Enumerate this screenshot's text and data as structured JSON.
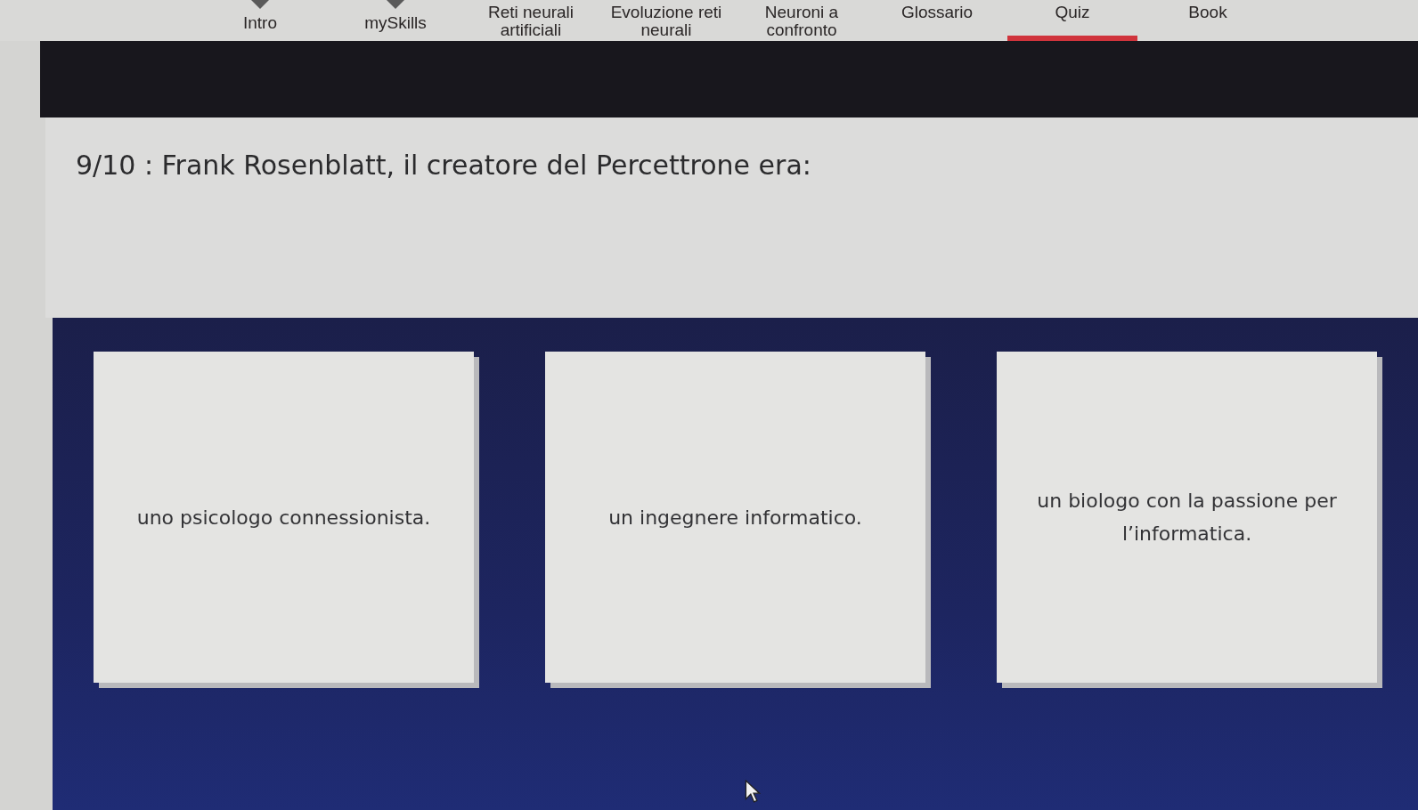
{
  "nav": {
    "items": [
      {
        "label": "Intro",
        "dropdown": true,
        "selected": false
      },
      {
        "label": "mySkills",
        "dropdown": true,
        "selected": false
      },
      {
        "label": "Reti neurali artificiali",
        "dropdown": false,
        "selected": false
      },
      {
        "label": "Evoluzione reti neurali",
        "dropdown": false,
        "selected": false
      },
      {
        "label": "Neuroni a confronto",
        "dropdown": false,
        "selected": false
      },
      {
        "label": "Glossario",
        "dropdown": false,
        "selected": false
      },
      {
        "label": "Quiz",
        "dropdown": false,
        "selected": true
      },
      {
        "label": "Book",
        "dropdown": false,
        "selected": false
      }
    ]
  },
  "question": {
    "text": "9/10 : Frank Rosenblatt, il creatore del Percettrone era:"
  },
  "answers": [
    {
      "text": "uno psicologo connessionista."
    },
    {
      "text": "un ingegnere informatico."
    },
    {
      "text": "un biologo con la passione per l’informatica."
    }
  ]
}
